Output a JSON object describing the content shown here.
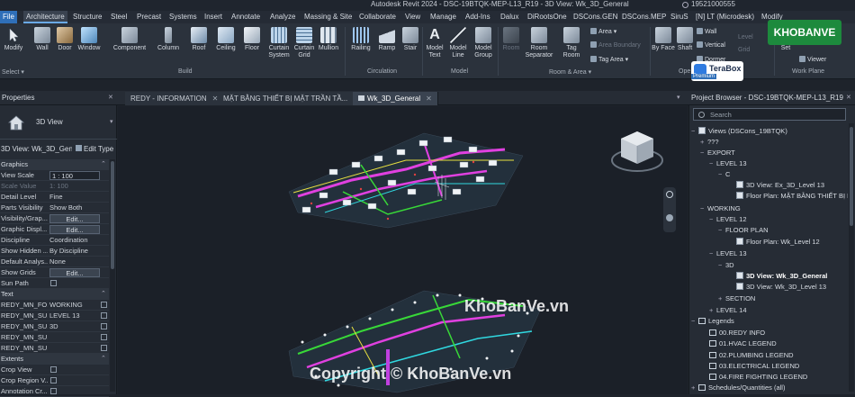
{
  "titlebar": {
    "title": "Autodesk Revit 2024 - DSC-19BTQK-MEP-L13_R19 - 3D View: Wk_3D_General",
    "user": "19521000555"
  },
  "ribbon_tabs": [
    "File",
    "Architecture",
    "Structure",
    "Steel",
    "Precast",
    "Systems",
    "Insert",
    "Annotate",
    "Analyze",
    "Massing & Site",
    "Collaborate",
    "View",
    "Manage",
    "Add-Ins",
    "Dalux",
    "DiRootsOne",
    "DSCons.GEN",
    "DSCons.MEP",
    "SiruS",
    "[N] LT (Microdesk)",
    "Modify"
  ],
  "ribbon": {
    "modify": "Modify",
    "select": "Select ▾",
    "wall": "Wall",
    "door": "Door",
    "window": "Window",
    "component": "Component",
    "column": "Column",
    "roof": "Roof",
    "ceiling": "Ceiling",
    "floor": "Floor",
    "curtain_system": "Curtain System",
    "curtain_grid": "Curtain Grid",
    "mullion": "Mullion",
    "railing": "Railing",
    "ramp": "Ramp",
    "stair": "Stair",
    "model_text": "Model Text",
    "model_line": "Model Line",
    "model_group": "Model Group",
    "room": "Room",
    "room_separator": "Room Separator",
    "tag_room": "Tag Room",
    "area": "Area ▾",
    "area_boundary": "Area Boundary",
    "tag_area": "Tag Area ▾",
    "by_face": "By Face",
    "shaft": "Shaft",
    "wall_small": "Wall",
    "vertical": "Vertical",
    "dormer": "Dormer",
    "level": "Level",
    "grid": "Grid",
    "set": "Set",
    "viewer": "Viewer",
    "groups": {
      "build": "Build",
      "circulation": "Circulation",
      "model": "Model",
      "room_area": "Room & Area ▾",
      "opening": "Ope",
      "work_plane": "Work Plane"
    }
  },
  "terabox": {
    "name": "TeraBox",
    "badge": "Premium"
  },
  "view_tabs": [
    {
      "label": "REDY - INFORMATION"
    },
    {
      "label": "MẶT BẰNG THIẾT BỊ MẶT TRẦN TẦ..."
    },
    {
      "label": "Wk_3D_General"
    }
  ],
  "properties": {
    "title": "Properties",
    "type_name": "3D View",
    "selector": "3D View: Wk_3D_Gene",
    "edit_type": "Edit Type",
    "sections": {
      "graphics": "Graphics",
      "text": "Text",
      "extents": "Extents"
    },
    "rows": [
      {
        "key": "View Scale",
        "value": "1 : 100"
      },
      {
        "key": "Scale Value",
        "value": "1: 100"
      },
      {
        "key": "Detail Level",
        "value": "Fine"
      },
      {
        "key": "Parts Visibility",
        "value": "Show Both"
      },
      {
        "key": "Visibility/Grap...",
        "value": "Edit..."
      },
      {
        "key": "Graphic Displ...",
        "value": "Edit..."
      },
      {
        "key": "Discipline",
        "value": "Coordination"
      },
      {
        "key": "Show Hidden ...",
        "value": "By Discipline"
      },
      {
        "key": "Default Analys...",
        "value": "None"
      },
      {
        "key": "Show Grids",
        "value": "Edit..."
      },
      {
        "key": "Sun Path",
        "value": ""
      }
    ],
    "text_rows": [
      {
        "key": "REDY_MN_FO...",
        "value": "WORKING"
      },
      {
        "key": "REDY_MN_SU...",
        "value": "LEVEL 13"
      },
      {
        "key": "REDY_MN_SU...",
        "value": "3D"
      },
      {
        "key": "REDY_MN_SU...",
        "value": ""
      },
      {
        "key": "REDY_MN_SU...",
        "value": ""
      }
    ],
    "extent_rows": [
      {
        "key": "Crop View",
        "value": ""
      },
      {
        "key": "Crop Region V...",
        "value": ""
      },
      {
        "key": "Annotation Cr...",
        "value": ""
      }
    ]
  },
  "project_browser": {
    "title": "Project Browser - DSC-19BTQK-MEP-L13_R19",
    "search_placeholder": "Search",
    "items": [
      {
        "label": "Views (DSCons_19BTQK)",
        "twisty": "−"
      },
      {
        "label": "???",
        "twisty": "+"
      },
      {
        "label": "EXPORT",
        "twisty": "−"
      },
      {
        "label": "LEVEL 13",
        "twisty": "−"
      },
      {
        "label": "C",
        "twisty": "−"
      },
      {
        "label": "3D View: Ex_3D_Level 13",
        "twisty": ""
      },
      {
        "label": "Floor Plan: MẶT BẰNG THIẾT BỊ M",
        "twisty": ""
      },
      {
        "label": "WORKING",
        "twisty": "−"
      },
      {
        "label": "LEVEL 12",
        "twisty": "−"
      },
      {
        "label": "FLOOR PLAN",
        "twisty": "−"
      },
      {
        "label": "Floor Plan: Wk_Level 12",
        "twisty": ""
      },
      {
        "label": "LEVEL 13",
        "twisty": "−"
      },
      {
        "label": "3D",
        "twisty": "−"
      },
      {
        "label": "3D View: Wk_3D_General",
        "twisty": ""
      },
      {
        "label": "3D View: Wk_3D_Level 13",
        "twisty": ""
      },
      {
        "label": "SECTION",
        "twisty": "+"
      },
      {
        "label": "LEVEL 14",
        "twisty": "+"
      },
      {
        "label": "Legends",
        "twisty": "−"
      },
      {
        "label": "00.REDY INFO",
        "twisty": ""
      },
      {
        "label": "01.HVAC LEGEND",
        "twisty": ""
      },
      {
        "label": "02.PLUMBING LEGEND",
        "twisty": ""
      },
      {
        "label": "03.ELECTRICAL LEGEND",
        "twisty": ""
      },
      {
        "label": "04.FIRE FIGHTING LEGEND",
        "twisty": ""
      },
      {
        "label": "Schedules/Quantities (all)",
        "twisty": "+"
      }
    ]
  },
  "watermark": {
    "logo": "KHOBANVE",
    "center": "KhoBanVe.vn",
    "bottom": "Copyright © KhoBanVe.vn"
  },
  "colors": {
    "accent": "#2f6fb8",
    "duct_magenta": "#e040e0",
    "pipe_green": "#38d838",
    "pipe_cyan": "#30d8e0",
    "pipe_yellow": "#e8e040",
    "brand_green": "#1d8a3d"
  }
}
